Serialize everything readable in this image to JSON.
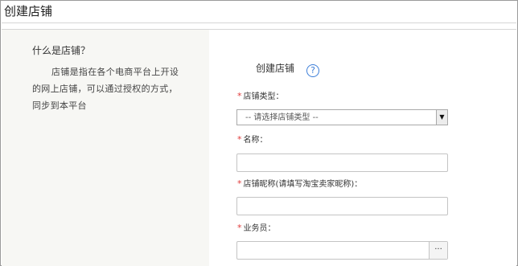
{
  "page": {
    "title": "创建店铺"
  },
  "sidebar": {
    "heading": "什么是店铺？",
    "description": "店铺是指在各个电商平台上开设的网上店铺，可以通过授权的方式，同步到本平台"
  },
  "form": {
    "title": "创建店铺",
    "help_icon": "?",
    "required_mark": "*",
    "store_type": {
      "label": "店铺类型：",
      "selected": "-- 请选择店铺类型 --",
      "arrow": "▼"
    },
    "name": {
      "label": "名称：",
      "value": ""
    },
    "nickname": {
      "label": "店铺昵称(请填写淘宝卖家昵称)：",
      "value": ""
    },
    "salesperson": {
      "label": "业务员：",
      "value": "",
      "picker_button": "···"
    }
  }
}
